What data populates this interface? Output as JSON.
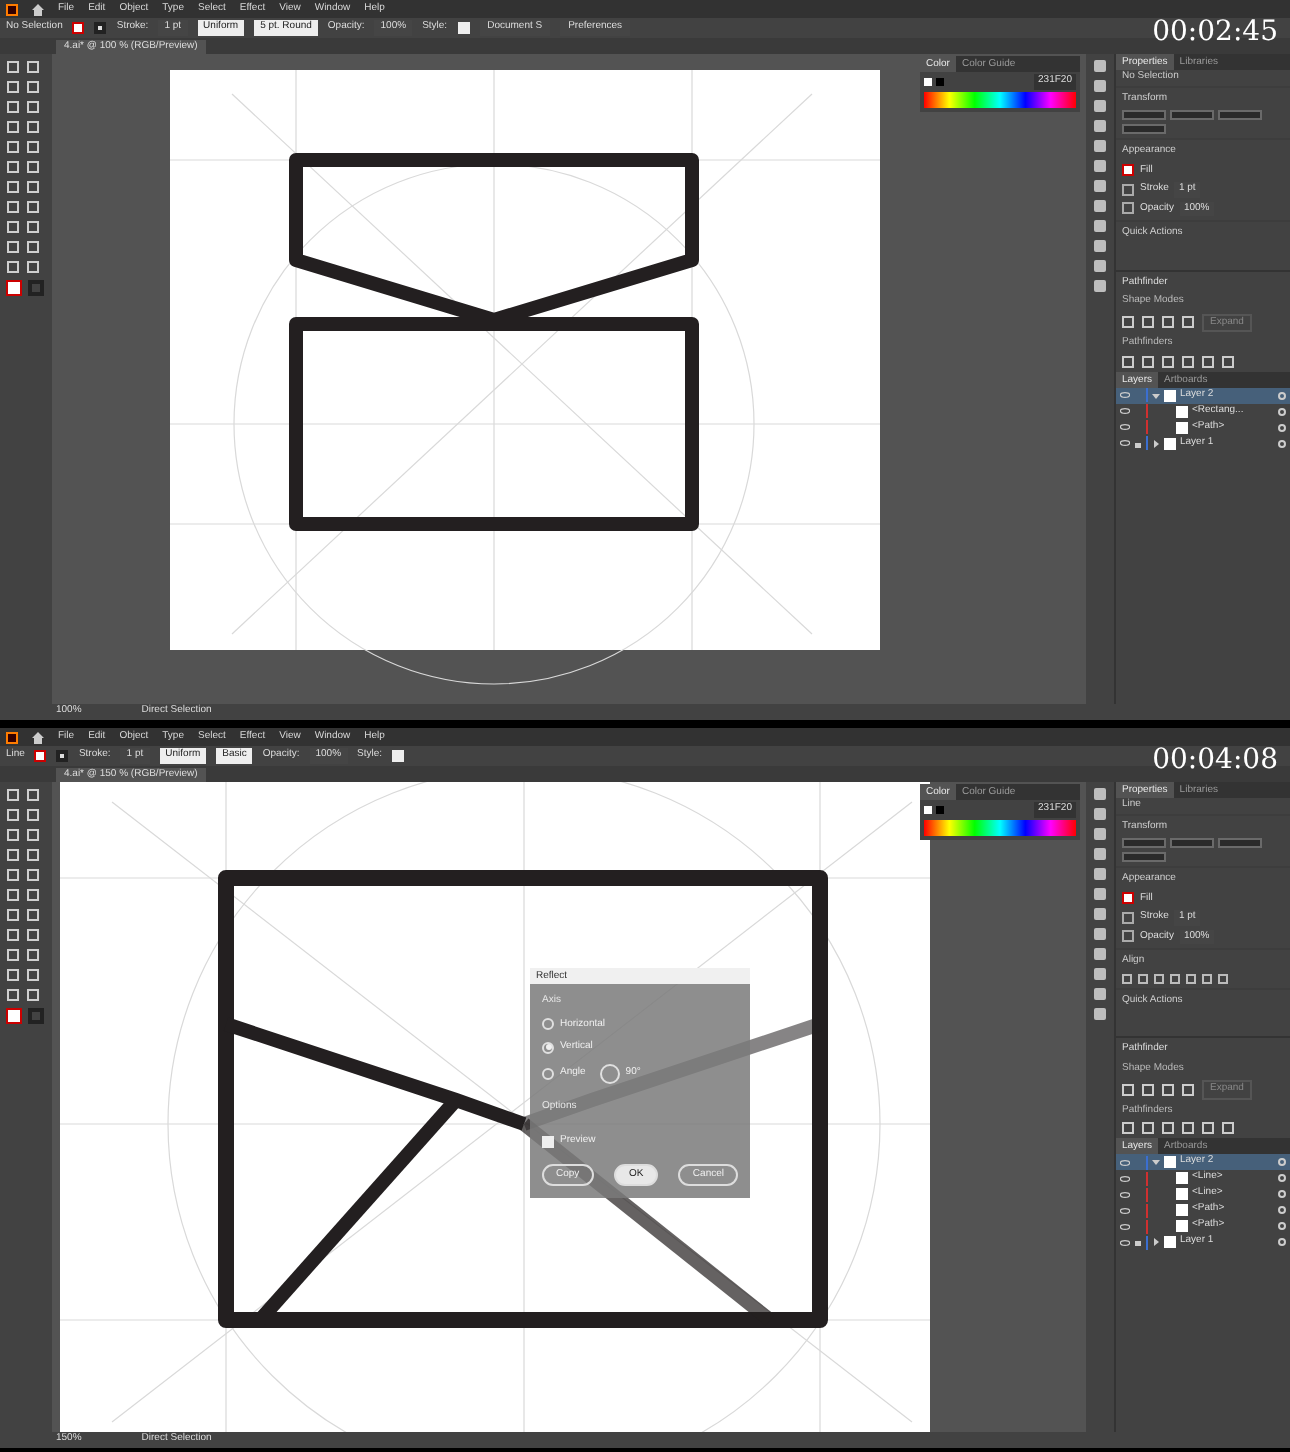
{
  "screens": [
    {
      "timestamp": "00:02:45",
      "menu": [
        "File",
        "Edit",
        "Object",
        "Type",
        "Select",
        "Effect",
        "View",
        "Window",
        "Help"
      ],
      "control_bar": {
        "selection": "No Selection",
        "stroke_label": "Stroke:",
        "stroke_weight": "1 pt",
        "profile": "Uniform",
        "brush": "5 pt. Round",
        "opacity_label": "Opacity:",
        "opacity": "100%",
        "style_label": "Style:",
        "buttons": [
          "Document S",
          "Preferences"
        ]
      },
      "document_tab": "4.ai* @ 100 % (RGB/Preview)",
      "artwork": {
        "kind": "closed"
      },
      "color_panel": {
        "tabs": [
          {
            "label": "Color",
            "selected": true
          },
          {
            "label": "Color Guide",
            "selected": false
          }
        ],
        "hex": "231F20"
      },
      "properties": {
        "tabs": [
          {
            "label": "Properties",
            "selected": true
          },
          {
            "label": "Libraries",
            "selected": false
          }
        ],
        "selection": "No Selection",
        "sections": [
          {
            "kind": "transform",
            "title": "Transform"
          },
          {
            "kind": "appearance",
            "title": "Appearance",
            "fill": "Fill",
            "stroke": "Stroke",
            "stroke_weight": "1 pt",
            "opacity": "Opacity",
            "opacity_value": "100%"
          },
          {
            "kind": "quick_actions",
            "title": "Quick Actions"
          }
        ]
      },
      "pathfinder": {
        "title": "Pathfinder",
        "shape_modes": "Shape Modes",
        "pathfinders": "Pathfinders",
        "expand": "Expand"
      },
      "layers": {
        "tabs": [
          {
            "label": "Layers",
            "selected": true
          },
          {
            "label": "Artboards",
            "selected": false
          }
        ],
        "items": [
          {
            "name": "Layer 2",
            "selected": true,
            "expanded": true,
            "locked": false,
            "children": [
              {
                "name": "<Rectang..."
              },
              {
                "name": "<Path>"
              }
            ]
          },
          {
            "name": "Layer 1",
            "selected": false,
            "expanded": false,
            "locked": true
          }
        ]
      },
      "status": {
        "zoom": "100%",
        "tool": "Direct Selection"
      }
    },
    {
      "timestamp": "00:04:08",
      "menu": [
        "File",
        "Edit",
        "Object",
        "Type",
        "Select",
        "Effect",
        "View",
        "Window",
        "Help"
      ],
      "control_bar": {
        "selection": "Line",
        "stroke_label": "Stroke:",
        "stroke_weight": "1 pt",
        "profile": "Uniform",
        "brush": "Basic",
        "opacity_label": "Opacity:",
        "opacity": "100%",
        "style_label": "Style:"
      },
      "document_tab": "4.ai* @ 150 % (RGB/Preview)",
      "artwork": {
        "kind": "open"
      },
      "color_panel": {
        "tabs": [
          {
            "label": "Color",
            "selected": true
          },
          {
            "label": "Color Guide",
            "selected": false
          }
        ],
        "hex": "231F20"
      },
      "properties": {
        "tabs": [
          {
            "label": "Properties",
            "selected": true
          },
          {
            "label": "Libraries",
            "selected": false
          }
        ],
        "selection": "Line",
        "sections": [
          {
            "kind": "transform",
            "title": "Transform"
          },
          {
            "kind": "appearance",
            "title": "Appearance",
            "fill": "Fill",
            "stroke": "Stroke",
            "stroke_weight": "1 pt",
            "opacity": "Opacity",
            "opacity_value": "100%"
          },
          {
            "kind": "align",
            "title": "Align"
          },
          {
            "kind": "quick_actions",
            "title": "Quick Actions"
          }
        ]
      },
      "pathfinder": {
        "title": "Pathfinder",
        "shape_modes": "Shape Modes",
        "pathfinders": "Pathfinders",
        "expand": "Expand"
      },
      "layers": {
        "tabs": [
          {
            "label": "Layers",
            "selected": true
          },
          {
            "label": "Artboards",
            "selected": false
          }
        ],
        "items": [
          {
            "name": "Layer 2",
            "selected": true,
            "expanded": true,
            "locked": false,
            "children": [
              {
                "name": "<Line>"
              },
              {
                "name": "<Line>"
              },
              {
                "name": "<Path>"
              },
              {
                "name": "<Path>"
              }
            ]
          },
          {
            "name": "Layer 1",
            "selected": false,
            "expanded": false,
            "locked": true
          }
        ]
      },
      "status": {
        "zoom": "150%",
        "tool": "Direct Selection"
      },
      "dialog": {
        "title": "Reflect",
        "axis_label": "Axis",
        "options": [
          {
            "label": "Horizontal",
            "selected": false
          },
          {
            "label": "Vertical",
            "selected": true
          },
          {
            "label": "Angle",
            "selected": false
          }
        ],
        "angle": "90°",
        "options_label": "Options",
        "preview": {
          "label": "Preview",
          "checked": true
        },
        "buttons": [
          "Copy",
          "OK",
          "Cancel"
        ]
      }
    }
  ]
}
